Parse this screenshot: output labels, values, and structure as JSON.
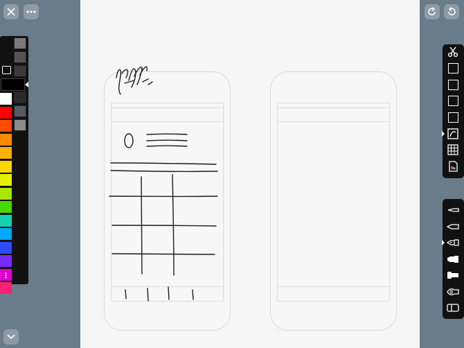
{
  "app": {
    "colors": {
      "background": "#6a7b8a",
      "paper": "#f6f6f7",
      "toolbar": "#111111",
      "button": "#8e9aa6"
    }
  },
  "top_left_buttons": [
    {
      "name": "close-button",
      "icon": "close-icon"
    },
    {
      "name": "more-button",
      "icon": "ellipsis-icon"
    }
  ],
  "top_right_buttons": [
    {
      "name": "redo-button",
      "icon": "redo-icon"
    },
    {
      "name": "undo-button",
      "icon": "undo-icon"
    }
  ],
  "palette": {
    "selected_color": "#000000",
    "left_column": [
      "#ffffff",
      "#ff0000",
      "#ff4a00",
      "#ff8c00",
      "#ffb000",
      "#ffd500",
      "#e3f000",
      "#a8e600",
      "#4cd600",
      "#12d3b0",
      "#00a8ff",
      "#2b4bff",
      "#7a28ff",
      "#e000d0",
      "#ff2277"
    ],
    "right_column": [
      "#7a7a7a",
      "#555555",
      "#3b3b3b",
      "#2a2a2a",
      "#555b63",
      "#8a8a8a"
    ]
  },
  "templates_toolbar": {
    "items": [
      "scissors-icon",
      "blank-page-icon",
      "blank-page-icon",
      "blank-page-icon",
      "blank-page-icon",
      "pen-page-icon",
      "grid-page-icon",
      "color-page-icon"
    ],
    "selected_index": 5
  },
  "tools_toolbar": {
    "items": [
      "fine-pen-icon",
      "pen-icon",
      "fountain-pen-icon",
      "marker-icon",
      "highlighter-icon",
      "brush-icon",
      "eraser-icon"
    ],
    "selected_index": 2
  }
}
